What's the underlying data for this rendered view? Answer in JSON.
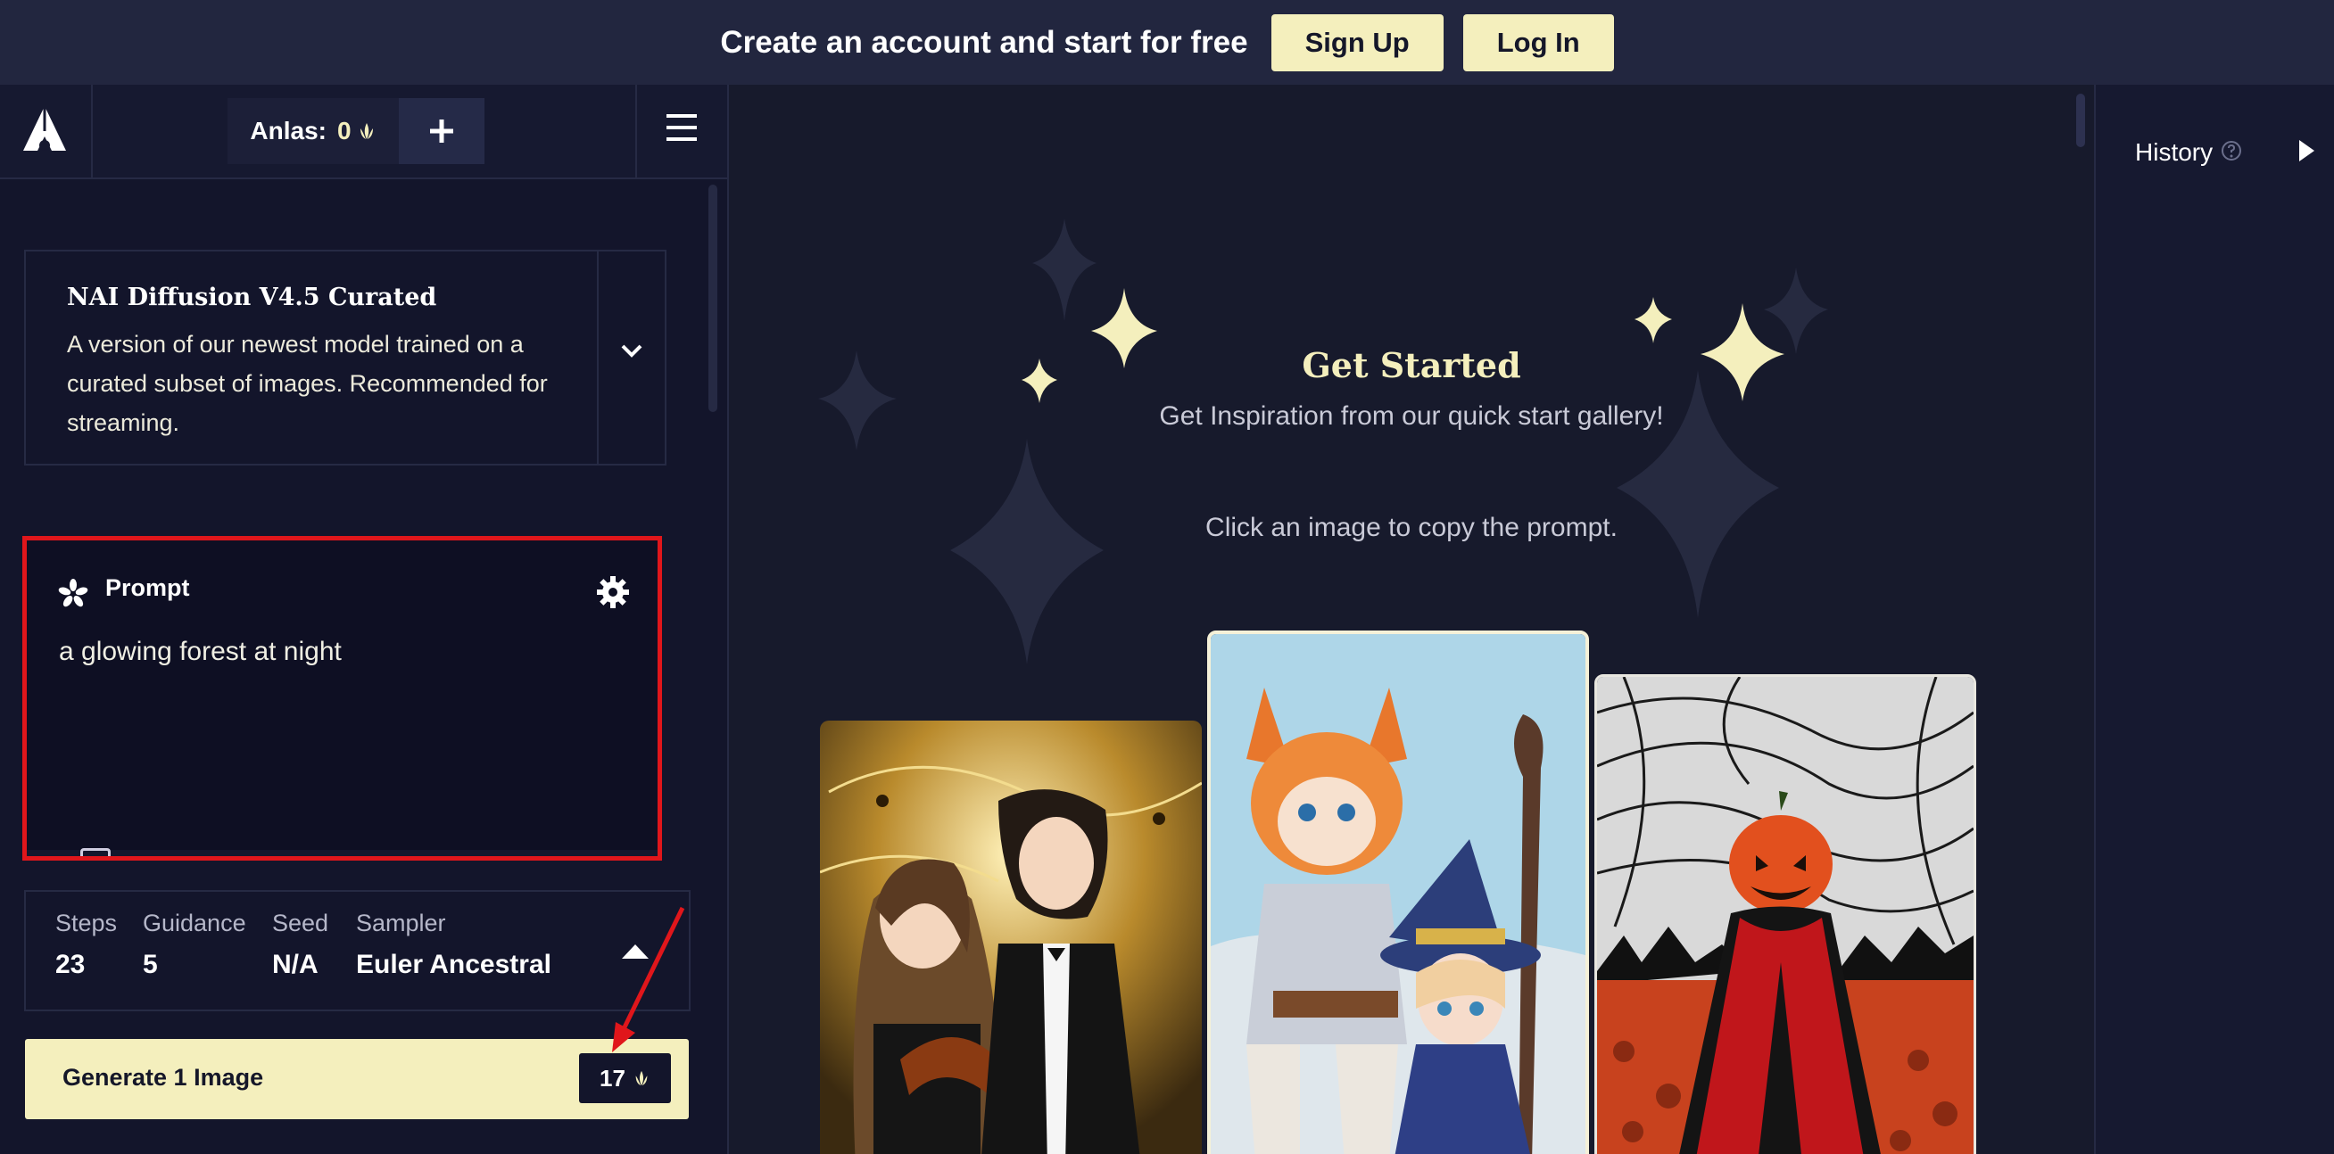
{
  "banner": {
    "message": "Create an account and start for free",
    "signup_label": "Sign Up",
    "login_label": "Log In"
  },
  "topbar": {
    "anlas_label": "Anlas:",
    "anlas_value": "0"
  },
  "model": {
    "name": "NAI Diffusion V4.5 Curated",
    "description": "A version of our newest model trained on a curated subset of images. Recommended for streaming."
  },
  "prompt": {
    "title": "Prompt",
    "text": "a glowing forest at night"
  },
  "params": {
    "steps_label": "Steps",
    "steps_value": "23",
    "guidance_label": "Guidance",
    "guidance_value": "5",
    "seed_label": "Seed",
    "seed_value": "N/A",
    "sampler_label": "Sampler",
    "sampler_value": "Euler Ancestral"
  },
  "generate": {
    "label": "Generate 1 Image",
    "cost": "17"
  },
  "main": {
    "title": "Get Started",
    "subtitle": "Get Inspiration from our quick start gallery!",
    "hint": "Click an image to copy the prompt."
  },
  "history": {
    "label": "History"
  },
  "colors": {
    "accent": "#f4efbd",
    "background": "#171a2c",
    "panel": "#13152b",
    "highlight_border": "#e0161b"
  }
}
